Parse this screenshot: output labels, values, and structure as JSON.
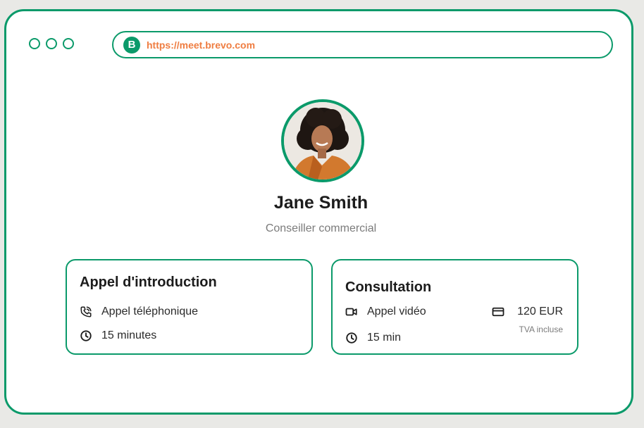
{
  "browser": {
    "url": "https://meet.brevo.com",
    "logo_letter": "B"
  },
  "profile": {
    "name": "Jane Smith",
    "role": "Conseiller commercial"
  },
  "cards": [
    {
      "title": "Appel d'introduction",
      "call_type": "Appel téléphonique",
      "duration": "15 minutes"
    },
    {
      "title": "Consultation",
      "call_type": "Appel vidéo",
      "duration": "15 min",
      "price": "120 EUR",
      "vat": "TVA incluse"
    }
  ],
  "icons": {
    "phone": "phone-icon",
    "clock": "clock-icon",
    "video": "video-camera-icon",
    "card": "credit-card-icon"
  },
  "colors": {
    "accent": "#0b9a6a",
    "url": "#ef7d41",
    "text": "#1c1c1c",
    "muted": "#7b7b7b"
  }
}
